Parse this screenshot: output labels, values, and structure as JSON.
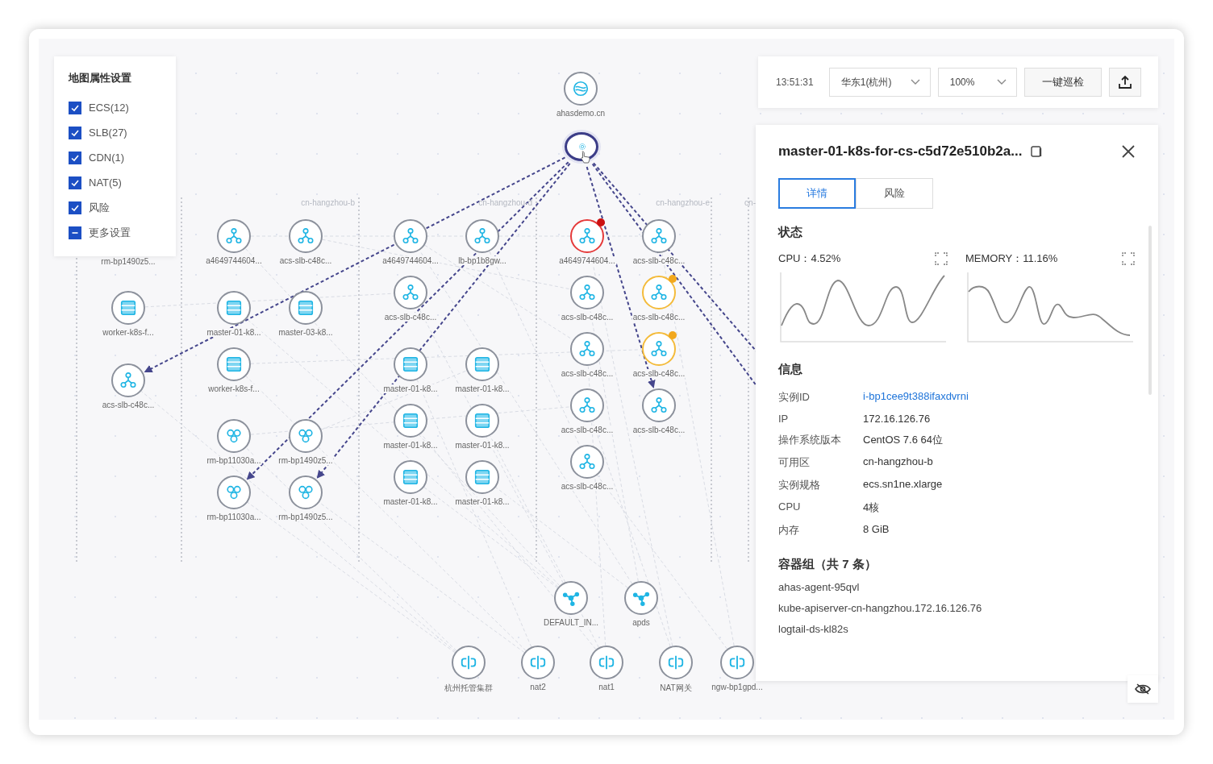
{
  "legend": {
    "title": "地图属性设置",
    "items": [
      {
        "label": "ECS(12)",
        "checked": true,
        "indeterminate": false
      },
      {
        "label": "SLB(27)",
        "checked": true,
        "indeterminate": false
      },
      {
        "label": "CDN(1)",
        "checked": true,
        "indeterminate": false
      },
      {
        "label": "NAT(5)",
        "checked": true,
        "indeterminate": false
      },
      {
        "label": "风险",
        "checked": true,
        "indeterminate": false
      },
      {
        "label": "更多设置",
        "checked": false,
        "indeterminate": true
      }
    ]
  },
  "covered_labels": [
    {
      "label": "rm-bp1490z5..."
    }
  ],
  "zones": [
    {
      "label": "cn-hangzhou-b"
    },
    {
      "label": "cn-hangzhou-d"
    },
    {
      "label": "cn-hangzhou-e"
    },
    {
      "label": "cn-"
    }
  ],
  "nodes": [
    {
      "label": "ahasdemo.cn",
      "kind": "cdn",
      "risk": false,
      "warning": false,
      "selected": false
    },
    {
      "kind": "gateway",
      "risk": false,
      "warning": false,
      "selected": true
    },
    {
      "label": "worker-k8s-f...",
      "kind": "ecs",
      "risk": false,
      "warning": false,
      "selected": false
    },
    {
      "label": "acs-slb-c48c...",
      "kind": "slb",
      "risk": false,
      "warning": false,
      "selected": false
    },
    {
      "label": "a4649744604...",
      "kind": "slb",
      "risk": false,
      "warning": false,
      "selected": false
    },
    {
      "label": "acs-slb-c48c...",
      "kind": "slb",
      "risk": false,
      "warning": false,
      "selected": false
    },
    {
      "label": "master-01-k8...",
      "kind": "ecs",
      "risk": false,
      "warning": false,
      "selected": false
    },
    {
      "label": "master-03-k8...",
      "kind": "ecs",
      "risk": false,
      "warning": false,
      "selected": false
    },
    {
      "label": "worker-k8s-f...",
      "kind": "ecs",
      "risk": false,
      "warning": false,
      "selected": false
    },
    {
      "label": "rm-bp11030a...",
      "kind": "rds",
      "risk": false,
      "warning": false,
      "selected": false
    },
    {
      "label": "rm-bp1490z5...",
      "kind": "rds",
      "risk": false,
      "warning": false,
      "selected": false
    },
    {
      "label": "rm-bp11030a...",
      "kind": "rds",
      "risk": false,
      "warning": false,
      "selected": false
    },
    {
      "label": "rm-bp1490z5...",
      "kind": "rds",
      "risk": false,
      "warning": false,
      "selected": false
    },
    {
      "label": "a4649744604...",
      "kind": "slb",
      "risk": false,
      "warning": false,
      "selected": false
    },
    {
      "label": "lb-bp1b8gw...",
      "kind": "slb",
      "risk": false,
      "warning": false,
      "selected": false
    },
    {
      "label": "acs-slb-c48c...",
      "kind": "slb",
      "risk": false,
      "warning": false,
      "selected": false
    },
    {
      "label": "master-01-k8...",
      "kind": "ecs",
      "risk": false,
      "warning": false,
      "selected": false
    },
    {
      "label": "master-01-k8...",
      "kind": "ecs",
      "risk": false,
      "warning": false,
      "selected": false
    },
    {
      "label": "master-01-k8...",
      "kind": "ecs",
      "risk": false,
      "warning": false,
      "selected": false
    },
    {
      "label": "master-01-k8...",
      "kind": "ecs",
      "risk": false,
      "warning": false,
      "selected": false
    },
    {
      "label": "master-01-k8...",
      "kind": "ecs",
      "risk": false,
      "warning": false,
      "selected": false
    },
    {
      "label": "master-01-k8...",
      "kind": "ecs",
      "risk": false,
      "warning": false,
      "selected": false
    },
    {
      "label": "a4649744604...",
      "kind": "slb",
      "risk": true,
      "warning": false,
      "selected": false
    },
    {
      "label": "acs-slb-c48c...",
      "kind": "slb",
      "risk": false,
      "warning": false,
      "selected": false
    },
    {
      "label": "acs-slb-c48c...",
      "kind": "slb",
      "risk": false,
      "warning": false,
      "selected": false
    },
    {
      "label": "acs-slb-c48c...",
      "kind": "slb",
      "risk": false,
      "warning": true,
      "selected": false
    },
    {
      "label": "acs-slb-c48c...",
      "kind": "slb",
      "risk": false,
      "warning": false,
      "selected": false
    },
    {
      "label": "acs-slb-c48c...",
      "kind": "slb",
      "risk": false,
      "warning": true,
      "selected": false
    },
    {
      "label": "acs-slb-c48c...",
      "kind": "slb",
      "risk": false,
      "warning": false,
      "selected": false
    },
    {
      "label": "acs-slb-c48c...",
      "kind": "slb",
      "risk": false,
      "warning": false,
      "selected": false
    },
    {
      "label": "acs-slb-c48c...",
      "kind": "slb",
      "risk": false,
      "warning": false,
      "selected": false
    },
    {
      "label": "DEFAULT_IN...",
      "kind": "net",
      "risk": false,
      "warning": false,
      "selected": false
    },
    {
      "label": "apds",
      "kind": "net",
      "risk": false,
      "warning": false,
      "selected": false
    },
    {
      "label": "杭州托管集群",
      "kind": "vpc",
      "risk": false,
      "warning": false,
      "selected": false
    },
    {
      "label": "nat2",
      "kind": "vpc",
      "risk": false,
      "warning": false,
      "selected": false
    },
    {
      "label": "nat1",
      "kind": "vpc",
      "risk": false,
      "warning": false,
      "selected": false
    },
    {
      "label": "NAT网关",
      "kind": "vpc",
      "risk": false,
      "warning": false,
      "selected": false
    },
    {
      "label": "ngw-bp1gpd...",
      "kind": "vpc",
      "risk": false,
      "warning": false,
      "selected": false
    }
  ],
  "toolbar": {
    "time": "13:51:31",
    "region_select": {
      "value": "华东1(杭州)"
    },
    "zoom_select": {
      "value": "100%"
    },
    "inspect_button": "一键巡检"
  },
  "detail": {
    "title": "master-01-k8s-for-cs-c5d72e510b2a...",
    "tabs": [
      {
        "label": "详情",
        "selected": true
      },
      {
        "label": "风险",
        "selected": false
      }
    ],
    "status_heading": "状态",
    "metrics": [
      {
        "label": "CPU：4.52%"
      },
      {
        "label": "MEMORY：11.16%"
      }
    ],
    "info_heading": "信息",
    "info": [
      {
        "key": "实例ID",
        "value": "i-bp1cee9t388ifaxdvrni",
        "kind": "link"
      },
      {
        "key": "IP",
        "value": "172.16.126.76",
        "kind": "text"
      },
      {
        "key": "操作系统版本",
        "value": "CentOS 7.6 64位",
        "kind": "text"
      },
      {
        "key": "可用区",
        "value": "cn-hangzhou-b",
        "kind": "text"
      },
      {
        "key": "实例规格",
        "value": "ecs.sn1ne.xlarge",
        "kind": "text"
      },
      {
        "key": "CPU",
        "value": "4核",
        "kind": "text"
      },
      {
        "key": "内存",
        "value": "8 GiB",
        "kind": "text"
      }
    ],
    "pods_heading": "容器组（共 7 条）",
    "pods": [
      "ahas-agent-95qvl",
      "kube-apiserver-cn-hangzhou.172.16.126.76",
      "logtail-ds-kl82s"
    ]
  }
}
